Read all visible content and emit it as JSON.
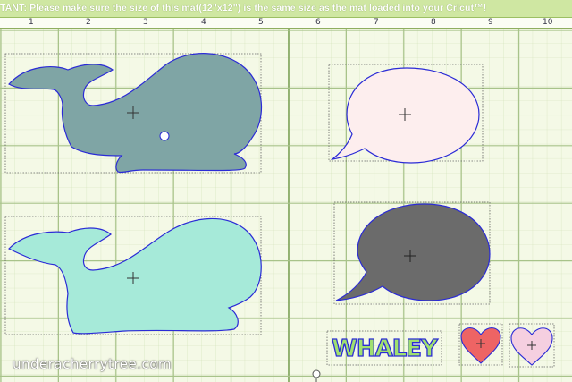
{
  "banner": {
    "text": "TANT: Please make sure the size of this mat(12\"x12\") is the same size as the mat loaded into your Cricut™!"
  },
  "ruler": {
    "labels": [
      "1",
      "2",
      "3",
      "4",
      "5",
      "6",
      "7",
      "8",
      "9",
      "10"
    ]
  },
  "shapes": {
    "whale_top_color": "#7fa5a5",
    "whale_bottom_color": "#a6ead9",
    "bubble_top_color": "#fdeeee",
    "bubble_bottom_color": "#6b6b6b",
    "heart_left_color": "#ee6464",
    "heart_right_color": "#f5cfe0",
    "outline_color": "#2b2bd6"
  },
  "whaley_text": {
    "text": "WHALEY"
  },
  "watermark": {
    "text": "underacherrytree.com"
  }
}
